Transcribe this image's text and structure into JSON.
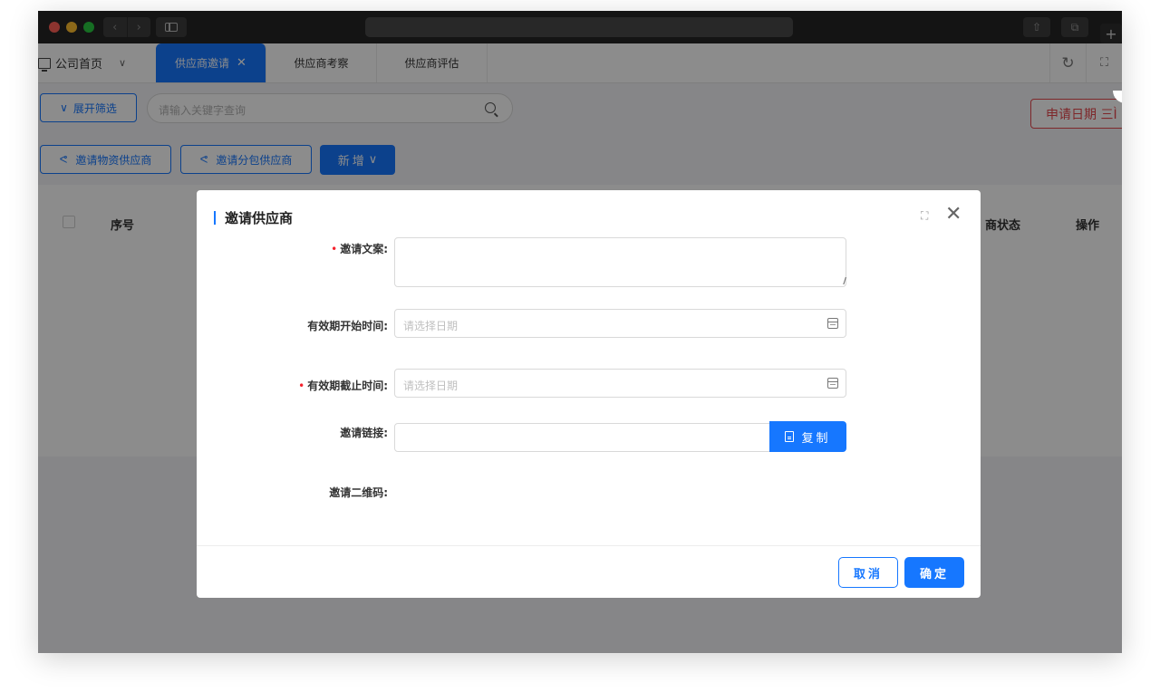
{
  "browser": {
    "tabs_symbol": "⧉",
    "plus_symbol": "+",
    "share_symbol": "⇧"
  },
  "tabbar": {
    "home": "公司首页",
    "tabs": [
      {
        "label": "供应商邀请",
        "active": true
      },
      {
        "label": "供应商考察",
        "active": false
      },
      {
        "label": "供应商评估",
        "active": false
      }
    ],
    "close_symbol": "✕",
    "refresh_symbol": "↻",
    "fullscreen_symbol": "⛶"
  },
  "toolbar": {
    "filter_label": "展开筛选",
    "search_placeholder": "请输入关键字查询",
    "date_label": "申请日期 三Ì",
    "invite_material": "邀请物资供应商",
    "invite_subcontract": "邀请分包供应商",
    "add_new": "新增"
  },
  "table": {
    "headers": [
      "序号",
      "商状态",
      "操作"
    ]
  },
  "modal": {
    "title": "邀请供应商",
    "fields": {
      "copy_text_label": "邀请文案:",
      "start_label": "有效期开始时间:",
      "start_placeholder": "请选择日期",
      "end_label": "有效期截止时间:",
      "end_placeholder": "请选择日期",
      "link_label": "邀请链接:",
      "qrcode_label": "邀请二维码:"
    },
    "required_mark": "•",
    "copy_button": "复制",
    "cancel": "取消",
    "confirm": "确定",
    "expand_symbol": "⛶",
    "close_symbol": "✕"
  },
  "colors": {
    "accent": "#1677ff",
    "danger": "#e5484d",
    "required": "#f5222d"
  }
}
